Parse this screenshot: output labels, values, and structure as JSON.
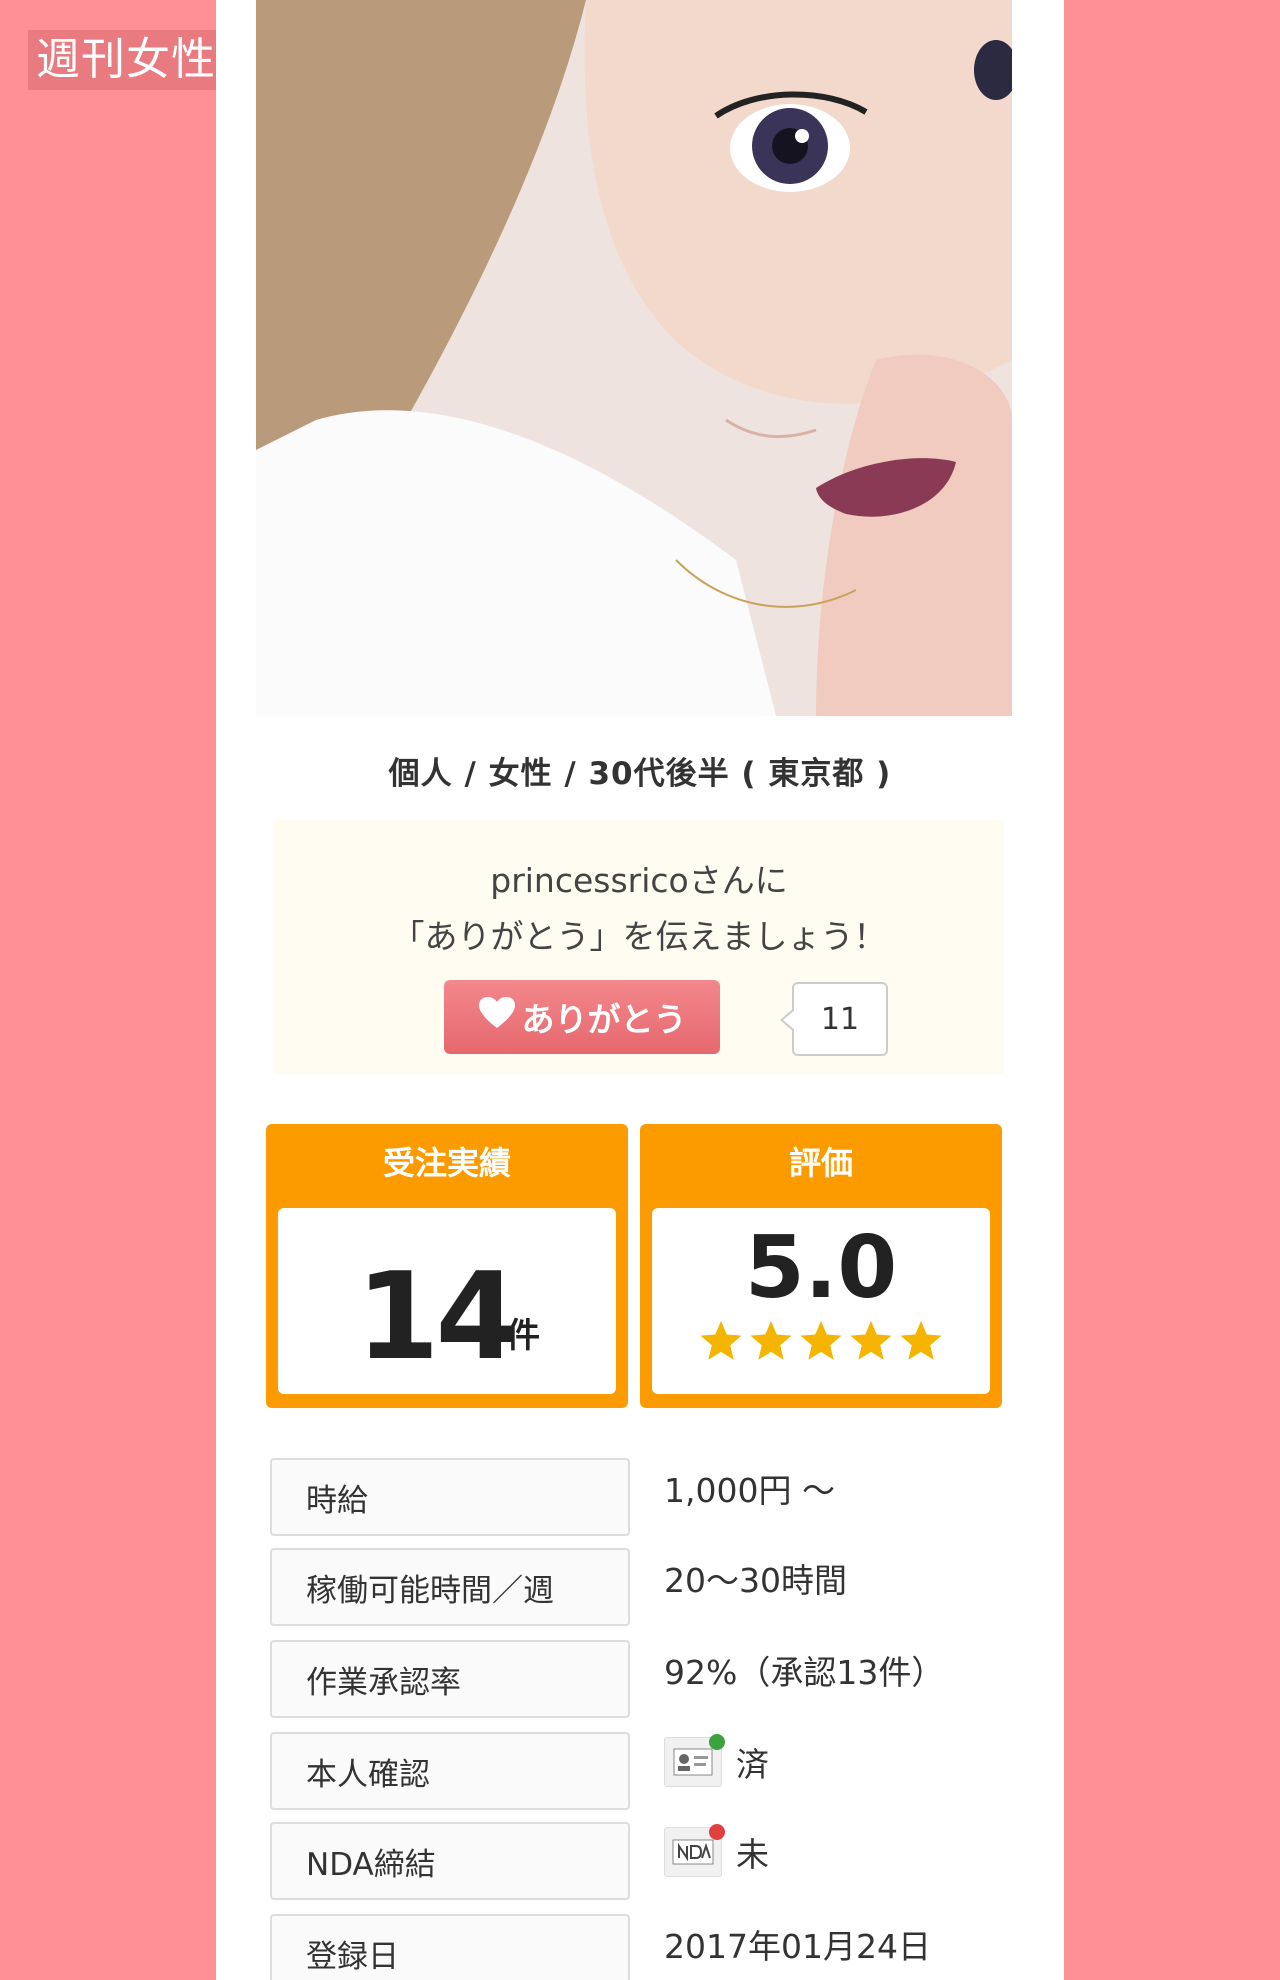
{
  "watermark": "週刊女性PRIME",
  "profile": {
    "meta": "個人 / 女性 / 30代後半 ( 東京都 )"
  },
  "thanks": {
    "line1": "princessricoさんに",
    "line2": "「ありがとう」を伝えましょう！",
    "button_label": "ありがとう",
    "count": "11"
  },
  "stats": {
    "orders": {
      "title": "受注実績",
      "value": "14",
      "unit": "件"
    },
    "rating": {
      "title": "評価",
      "value": "5.0",
      "stars": 5
    }
  },
  "info": [
    {
      "label": "時給",
      "value": "1,000円 ～"
    },
    {
      "label": "稼働可能時間／週",
      "value": "20～30時間"
    },
    {
      "label": "作業承認率",
      "value": "92%（承認13件）"
    },
    {
      "label": "本人確認",
      "value": "済"
    },
    {
      "label": "NDA締結",
      "value": "未"
    },
    {
      "label": "登録日",
      "value": "2017年01月24日"
    }
  ],
  "colors": {
    "background": "#ff9196",
    "accent_orange": "#fb9b00",
    "thanks_button": "#e5686e",
    "star": "#f5b400"
  },
  "icons": [
    "heart-icon",
    "star-icon",
    "id-card-icon",
    "nda-icon"
  ]
}
